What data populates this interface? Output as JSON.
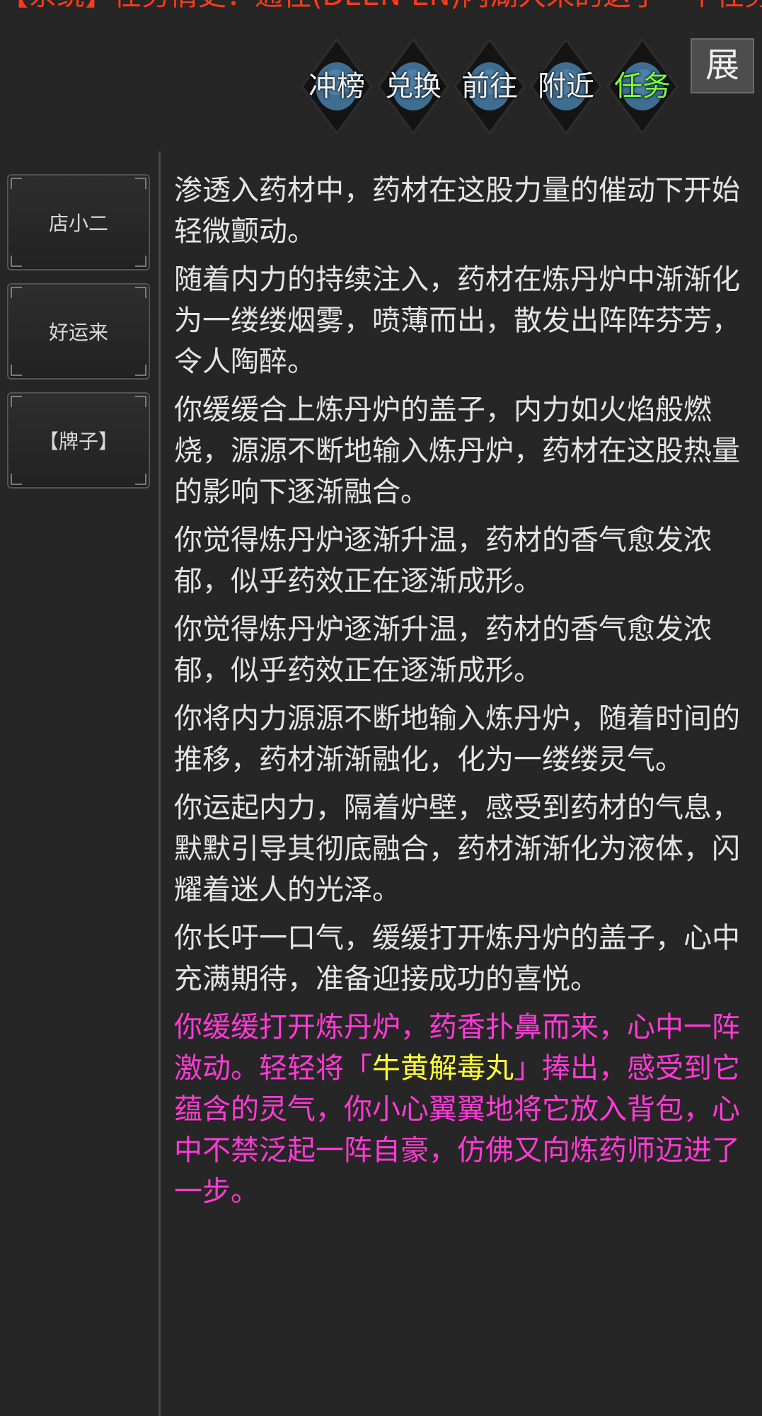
{
  "system_message": "【系统】任务情史：通往(DEEN-EN)内湖大来的这了一个任务。",
  "actions": [
    {
      "label": "冲榜",
      "active": false
    },
    {
      "label": "兑换",
      "active": false
    },
    {
      "label": "前往",
      "active": false
    },
    {
      "label": "附近",
      "active": false
    },
    {
      "label": "任务",
      "active": true
    }
  ],
  "expand_label": "展",
  "npcs": [
    {
      "label": "店小二"
    },
    {
      "label": "好运来"
    },
    {
      "label": "【牌子】"
    }
  ],
  "log": [
    "渗透入药材中，药材在这股力量的催动下开始轻微颤动。",
    "随着内力的持续注入，药材在炼丹炉中渐渐化为一缕缕烟雾，喷薄而出，散发出阵阵芬芳，令人陶醉。",
    "你缓缓合上炼丹炉的盖子，内力如火焰般燃烧，源源不断地输入炼丹炉，药材在这股热量的影响下逐渐融合。",
    "你觉得炼丹炉逐渐升温，药材的香气愈发浓郁，似乎药效正在逐渐成形。",
    "你觉得炼丹炉逐渐升温，药材的香气愈发浓郁，似乎药效正在逐渐成形。",
    "你将内力源源不断地输入炼丹炉，随着时间的推移，药材渐渐融化，化为一缕缕灵气。",
    "你运起内力，隔着炉壁，感受到药材的气息，默默引导其彻底融合，药材渐渐化为液体，闪耀着迷人的光泽。",
    "你长吁一口气，缓缓打开炼丹炉的盖子，心中充满期待，准备迎接成功的喜悦。"
  ],
  "final_message": {
    "before": "你缓缓打开炼丹炉，药香扑鼻而来，心中一阵激动。轻轻将「",
    "item": "牛黄解毒丸",
    "after": "」捧出，感受到它蕴含的灵气，你小心翼翼地将它放入背包，心中不禁泛起一阵自豪，仿佛又向炼药师迈进了一步。"
  },
  "colors": {
    "background": "#262626",
    "system_text": "#ff3a1a",
    "active_action": "#7dff3a",
    "highlight_text": "#ff3ad6",
    "item_text": "#ffff3a"
  }
}
